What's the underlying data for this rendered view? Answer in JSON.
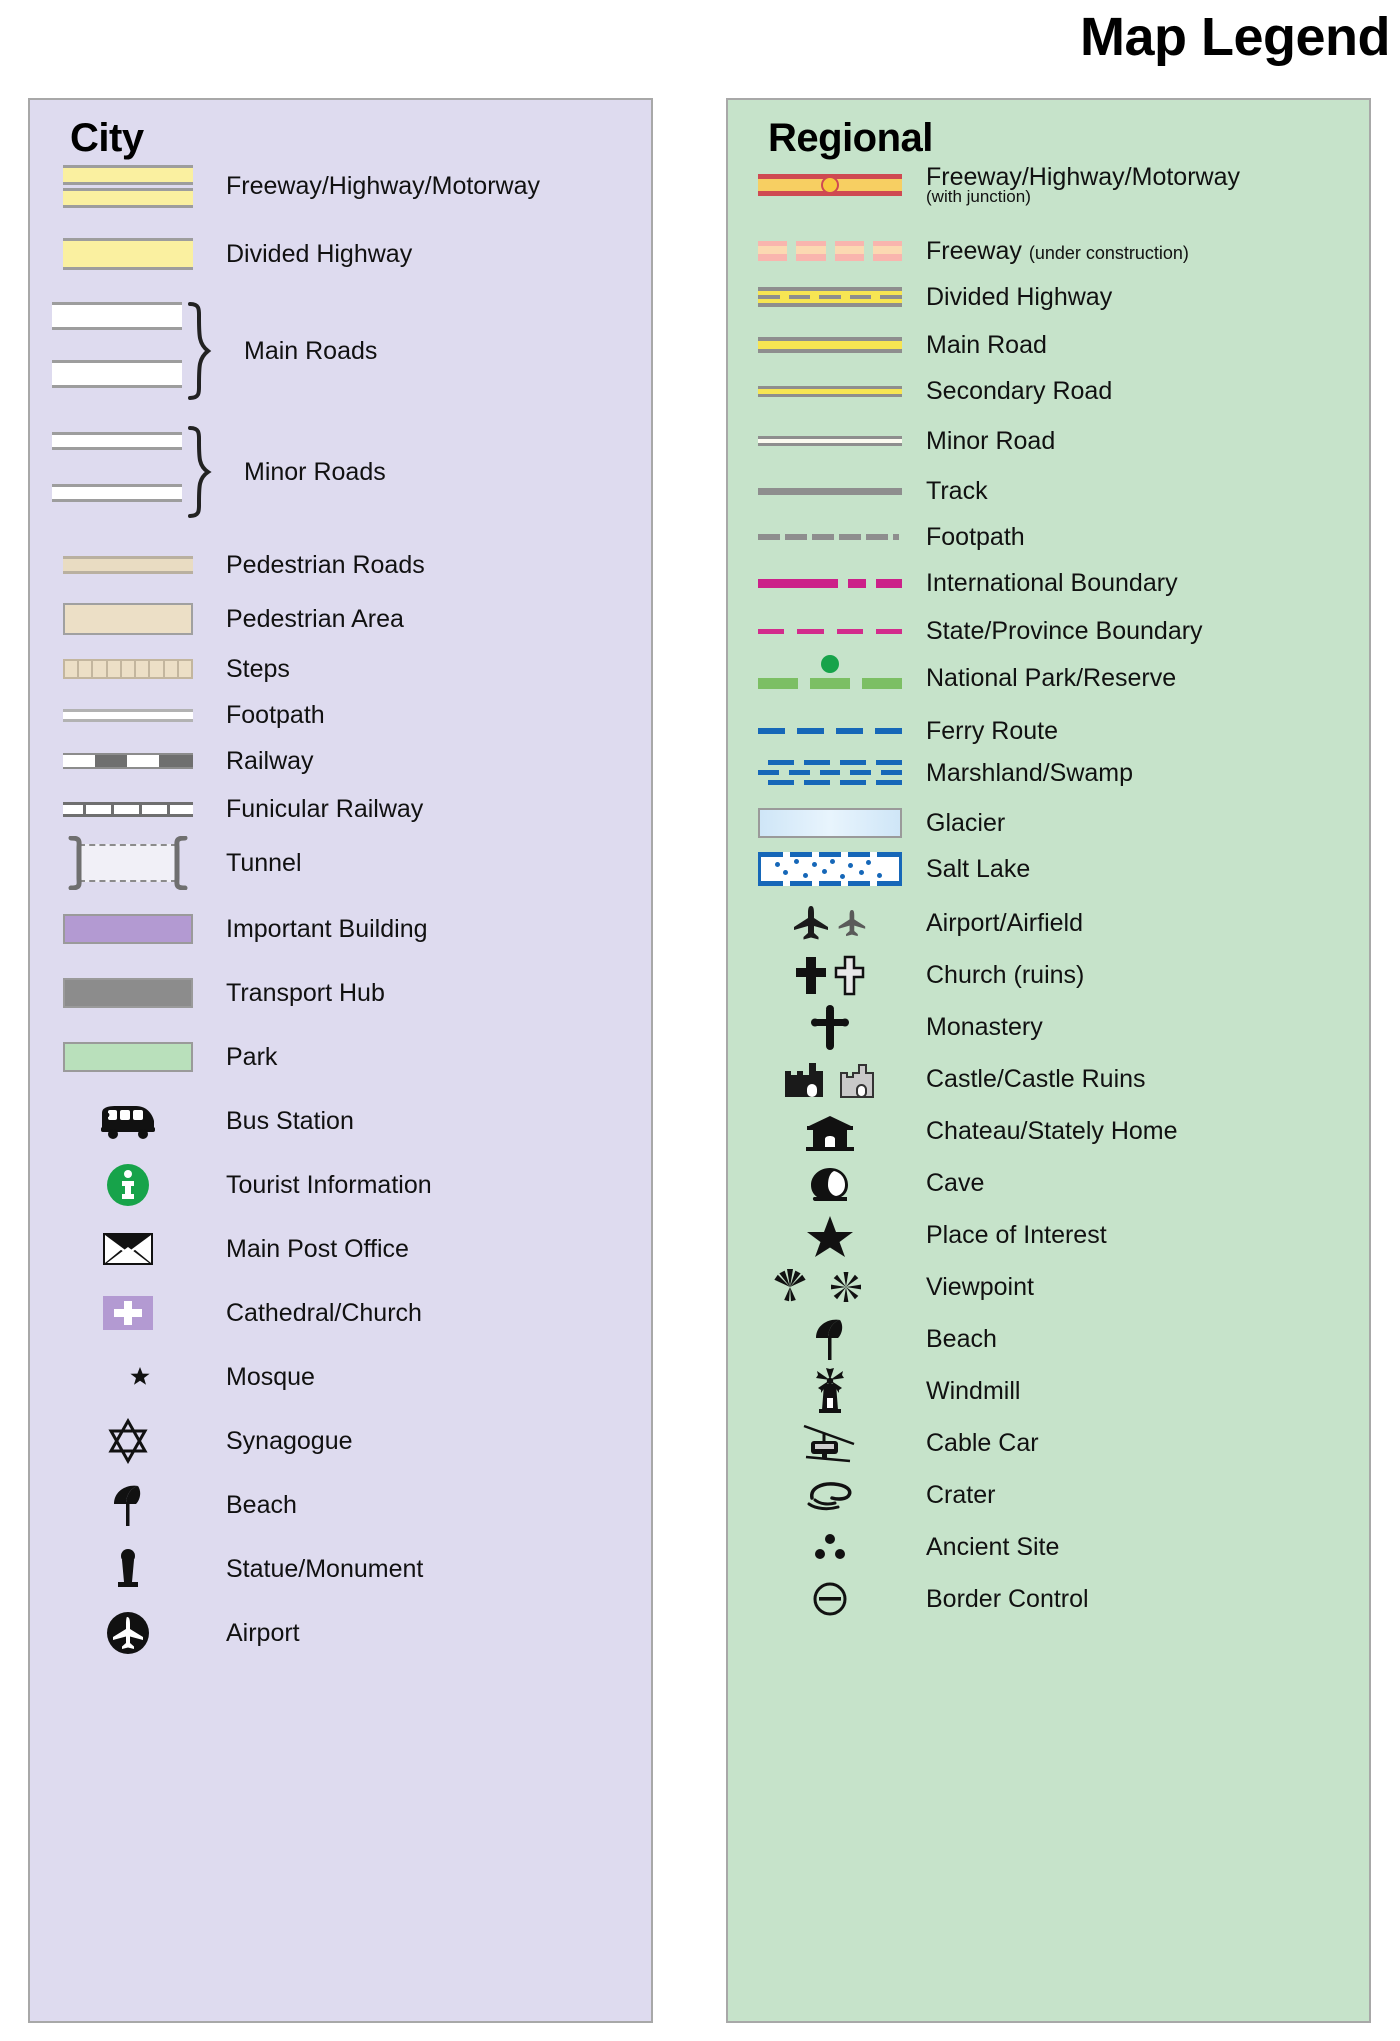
{
  "title": "Map Legend",
  "city": {
    "heading": "City",
    "items": [
      {
        "label": "Freeway/Highway/Motorway",
        "symbol": "freeway-double-band"
      },
      {
        "label": "Divided Highway",
        "symbol": "divided-highway-band"
      },
      {
        "label": "Main Roads",
        "symbol": "main-roads-braced-pair"
      },
      {
        "label": "Minor Roads",
        "symbol": "minor-roads-braced-pair"
      },
      {
        "label": "Pedestrian Roads",
        "symbol": "pedestrian-road-band"
      },
      {
        "label": "Pedestrian Area",
        "symbol": "pedestrian-area-block"
      },
      {
        "label": "Steps",
        "symbol": "steps-hatched-band"
      },
      {
        "label": "Footpath",
        "symbol": "footpath-thin-band"
      },
      {
        "label": "Railway",
        "symbol": "railway-dashed-band"
      },
      {
        "label": "Funicular Railway",
        "symbol": "funicular-ticked-band"
      },
      {
        "label": "Tunnel",
        "symbol": "tunnel-bracket-dashed"
      },
      {
        "label": "Important Building",
        "symbol": "important-building-swatch"
      },
      {
        "label": "Transport Hub",
        "symbol": "transport-hub-swatch"
      },
      {
        "label": "Park",
        "symbol": "park-swatch"
      },
      {
        "label": "Bus Station",
        "symbol": "bus-icon"
      },
      {
        "label": "Tourist Information",
        "symbol": "information-circle-icon"
      },
      {
        "label": "Main Post Office",
        "symbol": "envelope-icon"
      },
      {
        "label": "Cathedral/Church",
        "symbol": "church-cross-square-icon"
      },
      {
        "label": "Mosque",
        "symbol": "crescent-star-icon"
      },
      {
        "label": "Synagogue",
        "symbol": "star-of-david-icon"
      },
      {
        "label": "Beach",
        "symbol": "beach-umbrella-icon"
      },
      {
        "label": "Statue/Monument",
        "symbol": "monument-icon"
      },
      {
        "label": "Airport",
        "symbol": "airport-circle-icon"
      }
    ]
  },
  "regional": {
    "heading": "Regional",
    "items": [
      {
        "label": "Freeway/Highway/Motorway",
        "sublabel": "(with junction)",
        "symbol": "freeway-with-junction"
      },
      {
        "label": "Freeway",
        "sublabel": "(under construction)",
        "symbol": "freeway-under-construction"
      },
      {
        "label": "Divided Highway",
        "symbol": "divided-highway-dashed-centerline"
      },
      {
        "label": "Main Road",
        "symbol": "main-road-yellow-band"
      },
      {
        "label": "Secondary Road",
        "symbol": "secondary-road-thin-yellow-band"
      },
      {
        "label": "Minor Road",
        "symbol": "minor-road-white-band"
      },
      {
        "label": "Track",
        "symbol": "track-grey-line"
      },
      {
        "label": "Footpath",
        "symbol": "footpath-grey-dashed"
      },
      {
        "label": "International Boundary",
        "symbol": "international-boundary-dashdot"
      },
      {
        "label": "State/Province Boundary",
        "symbol": "state-boundary-dashed"
      },
      {
        "label": "National Park/Reserve",
        "symbol": "national-park-band-dot"
      },
      {
        "label": "Ferry Route",
        "symbol": "ferry-route-blue-dashed"
      },
      {
        "label": "Marshland/Swamp",
        "symbol": "marshland-tick-rows"
      },
      {
        "label": "Glacier",
        "symbol": "glacier-swatch"
      },
      {
        "label": "Salt Lake",
        "symbol": "salt-lake-dotted-swatch"
      },
      {
        "label": "Airport/Airfield",
        "symbol": "airplane-pair-icon"
      },
      {
        "label": "Church (ruins)",
        "symbol": "cross-pair-icon"
      },
      {
        "label": "Monastery",
        "symbol": "orthodox-cross-icon"
      },
      {
        "label": "Castle/Castle Ruins",
        "symbol": "castle-pair-icon"
      },
      {
        "label": "Chateau/Stately Home",
        "symbol": "chateau-icon"
      },
      {
        "label": "Cave",
        "symbol": "cave-icon"
      },
      {
        "label": "Place of Interest",
        "symbol": "star-icon"
      },
      {
        "label": "Viewpoint",
        "symbol": "viewpoint-pair-icon"
      },
      {
        "label": "Beach",
        "symbol": "beach-umbrella-icon"
      },
      {
        "label": "Windmill",
        "symbol": "windmill-icon"
      },
      {
        "label": "Cable Car",
        "symbol": "cable-car-icon"
      },
      {
        "label": "Crater",
        "symbol": "crater-icon"
      },
      {
        "label": "Ancient Site",
        "symbol": "ancient-site-icon"
      },
      {
        "label": "Border Control",
        "symbol": "border-control-icon"
      }
    ]
  },
  "colors": {
    "city_panel_bg": "#dedbef",
    "regional_panel_bg": "#c6e3ca",
    "panel_border": "#a8a8a8",
    "highway_yellow": "#faf0a0",
    "regional_road_yellow": "#f7e552",
    "freeway_red": "#cf4a52",
    "freeway_orange": "#f7cf62",
    "pedestrian_tan": "#ecdfc6",
    "important_building_purple": "#b39ad2",
    "transport_hub_grey": "#8c8c8c",
    "park_green": "#b9e0bb",
    "tourist_info_green": "#17a34a",
    "boundary_magenta": "#cc2189",
    "national_park_green": "#7cbf64",
    "water_blue": "#1667b8",
    "glacier_blue": "#cfe6f7",
    "road_casing_grey": "#8e8e8e"
  }
}
